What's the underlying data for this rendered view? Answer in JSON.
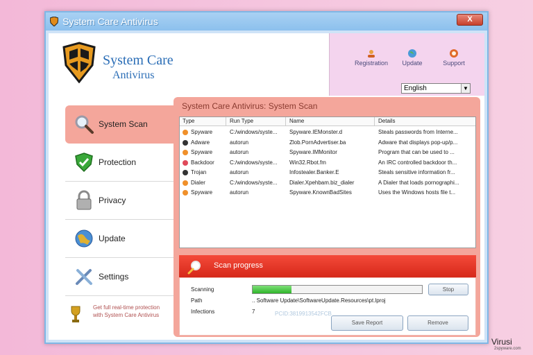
{
  "window": {
    "title": "System Care Antivirus",
    "close_label": "X"
  },
  "logo": {
    "title": "System Care",
    "subtitle": "Antivirus"
  },
  "top_actions": [
    {
      "label": "Registration",
      "icon": "registration-icon"
    },
    {
      "label": "Update",
      "icon": "update-globe-icon"
    },
    {
      "label": "Support",
      "icon": "support-icon"
    }
  ],
  "language": {
    "selected": "English"
  },
  "sidebar": {
    "items": [
      {
        "label": "System Scan",
        "icon": "magnifier-icon",
        "active": true
      },
      {
        "label": "Protection",
        "icon": "shield-check-icon"
      },
      {
        "label": "Privacy",
        "icon": "padlock-icon"
      },
      {
        "label": "Update",
        "icon": "globe-icon"
      },
      {
        "label": "Settings",
        "icon": "tools-icon"
      }
    ]
  },
  "promo": {
    "text": "Get full real-time protection with System Care Antivirus"
  },
  "panel": {
    "title": "System Care Antivirus: System Scan"
  },
  "table": {
    "columns": [
      "Type",
      "Run Type",
      "Name",
      "Details"
    ],
    "rows": [
      {
        "type": "Spyware",
        "run_type": "C:/windows/syste...",
        "name": "Spyware.IEMonster.d",
        "details": "Steals passwords from Interne...",
        "dot": "#f0902a"
      },
      {
        "type": "Adware",
        "run_type": "autorun",
        "name": "Zlob.PornAdvertiser.ba",
        "details": "Adware that displays pop-up/p...",
        "dot": "#333333"
      },
      {
        "type": "Spyware",
        "run_type": "autorun",
        "name": "Spyware.IMMonitor",
        "details": "Program that can be used to ...",
        "dot": "#f0902a"
      },
      {
        "type": "Backdoor",
        "run_type": "C:/windows/syste...",
        "name": "Win32.Rbot.fm",
        "details": "An IRC controlled backdoor th...",
        "dot": "#e04a5a"
      },
      {
        "type": "Trojan",
        "run_type": "autorun",
        "name": "Infostealer.Banker.E",
        "details": "Steals sensitive information fr...",
        "dot": "#333333"
      },
      {
        "type": "Dialer",
        "run_type": "C:/windows/syste...",
        "name": "Dialer.Xpehbam.biz_dialer",
        "details": "A Dialer that loads pornographi...",
        "dot": "#f0902a"
      },
      {
        "type": "Spyware",
        "run_type": "autorun",
        "name": "Spyware.KnownBadSites",
        "details": "Uses the Windows hosts file t...",
        "dot": "#f0902a"
      }
    ]
  },
  "scan": {
    "title": "Scan progress",
    "scanning_label": "Scanning",
    "progress_fraction": 0.23,
    "stop_label": "Stop",
    "path_label": "Path",
    "path_value": ".. Software Update\\SoftwareUpdate.Resources\\pt.lproj",
    "infections_label": "Infections",
    "infections_value": "7",
    "save_report_label": "Save Report",
    "remove_label": "Remove"
  },
  "footer": {
    "code": "PCID:3819913542FCB"
  },
  "watermark": {
    "text": "Virusi",
    "sub": "2spyware.com"
  },
  "colors": {
    "accent_panel": "#f4a69b",
    "scan_bar": "#e0321f",
    "brand_blue": "#2a6db6"
  }
}
